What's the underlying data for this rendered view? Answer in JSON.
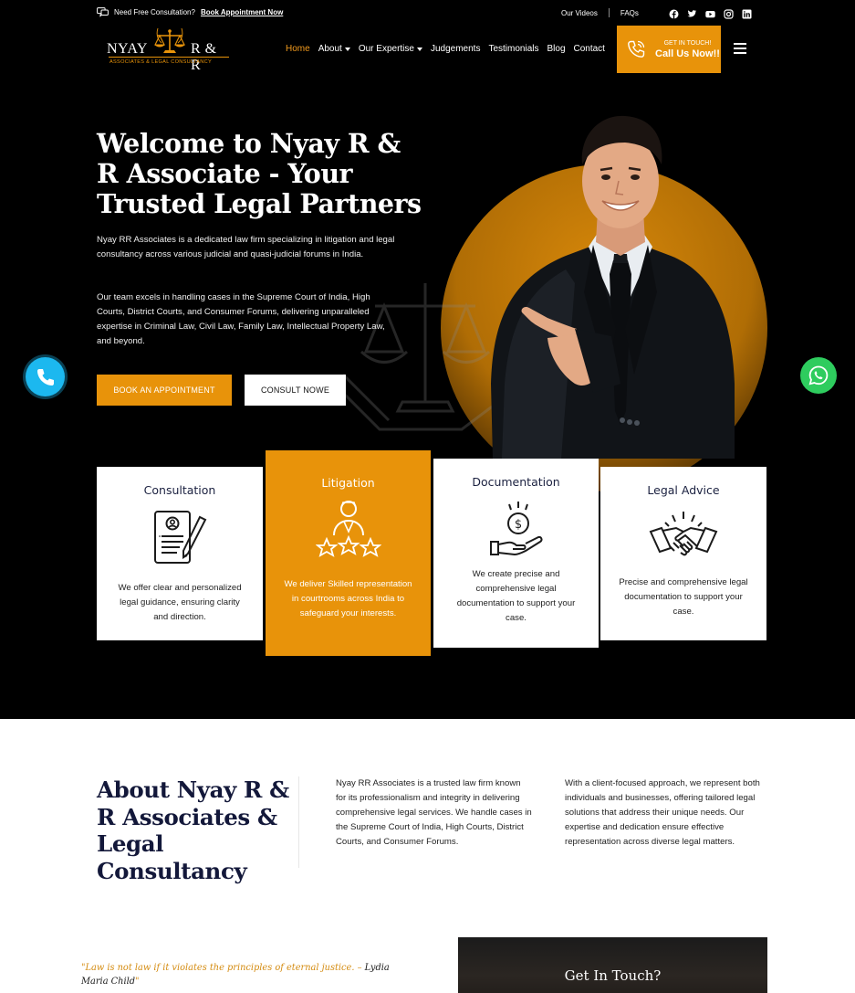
{
  "topbar": {
    "consult_text": "Need Free Consultation?",
    "book_link": "Book Appointment Now",
    "our_videos": "Our Videos",
    "faqs": "FAQs",
    "social_icons": [
      "facebook-icon",
      "twitter-icon",
      "youtube-icon",
      "instagram-icon",
      "linkedin-icon"
    ]
  },
  "logo": {
    "left": "NYAY",
    "right": "R & R",
    "tagline": "ASSOCIATES & LEGAL CONSULTANCY"
  },
  "nav": {
    "home": "Home",
    "about": "About",
    "expertise": "Our Expertise",
    "judgements": "Judgements",
    "testimonials": "Testimonials",
    "blog": "Blog",
    "contact": "Contact"
  },
  "cta": {
    "line1": "GET IN TOUCH!",
    "line2": "Call Us Now!!"
  },
  "hero": {
    "title": "Welcome to Nyay R & R Associate - Your Trusted Legal Partners",
    "para1": "Nyay RR Associates is a dedicated law firm specializing in litigation and legal consultancy across various judicial and quasi-judicial forums in India.",
    "para2": "Our team excels in handling cases in the Supreme Court of India, High Courts, District Courts, and Consumer Forums, delivering unparalleled expertise in Criminal Law, Civil Law, Family Law, Intellectual Property Law, and beyond.",
    "btn_book": "BOOK AN APPOINTMENT",
    "btn_consult": "CONSULT NOWE"
  },
  "services": [
    {
      "title": "Consultation",
      "desc": "We offer clear and personalized legal guidance, ensuring clarity and direction."
    },
    {
      "title": "Litigation",
      "desc": "We deliver Skilled representation in courtrooms across India to safeguard your interests."
    },
    {
      "title": "Documentation",
      "desc": "We create precise and comprehensive legal documentation to support your case."
    },
    {
      "title": "Legal Advice",
      "desc": "Precise and comprehensive legal documentation to support your case."
    }
  ],
  "about": {
    "title": "About Nyay R & R Associates & Legal Consultancy",
    "col1": "Nyay RR Associates is a trusted law firm known for its professionalism and integrity in delivering comprehensive legal services. We handle cases in the Supreme Court of India, High Courts, District Courts, and Consumer Forums.",
    "col2": "With a client-focused approach, we represent both individuals and businesses, offering tailored legal solutions that address their unique needs. Our expertise and dedication ensure effective representation across diverse legal matters."
  },
  "quote": {
    "text": "\"Law is not law if it violates the principles of eternal justice. –",
    "author": "Lydia Maria Child",
    "close": "\""
  },
  "get_in_touch": {
    "title": "Get In Touch?"
  },
  "colors": {
    "accent": "#e8930a",
    "hero_bg": "#000000",
    "heading_navy": "#13183a",
    "call_float": "#1cb8ef",
    "whatsapp_float": "#2ecc5e"
  }
}
